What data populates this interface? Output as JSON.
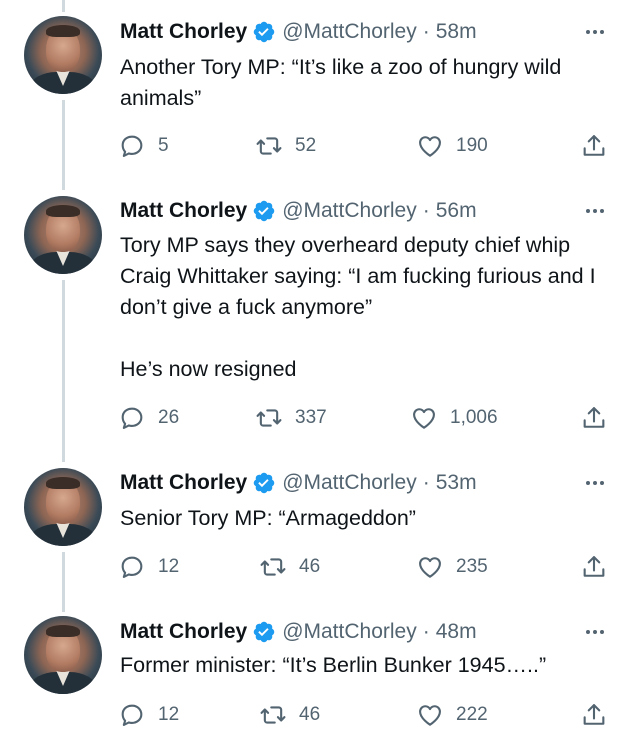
{
  "thread": {
    "tweets": [
      {
        "name": "Matt Chorley",
        "handle": "@MattChorley",
        "separator": "·",
        "time": "58m",
        "text": "Another Tory MP: “It’s like a zoo of hungry wild animals”",
        "replies": "5",
        "retweets": "52",
        "likes": "190"
      },
      {
        "name": "Matt Chorley",
        "handle": "@MattChorley",
        "separator": "·",
        "time": "56m",
        "text": "Tory MP says they overheard deputy chief whip Craig Whittaker saying: “I am fucking furious and I don’t give a fuck anymore”\n\nHe’s now resigned",
        "replies": "26",
        "retweets": "337",
        "likes": "1,006"
      },
      {
        "name": "Matt Chorley",
        "handle": "@MattChorley",
        "separator": "·",
        "time": "53m",
        "text": "Senior Tory MP: “Armageddon”",
        "replies": "12",
        "retweets": "46",
        "likes": "235"
      },
      {
        "name": "Matt Chorley",
        "handle": "@MattChorley",
        "separator": "·",
        "time": "48m",
        "text": "Former minister: “It’s Berlin Bunker 1945…..”",
        "replies": "12",
        "retweets": "46",
        "likes": "222"
      }
    ]
  },
  "icons": {
    "verified": "verified-badge-icon",
    "more": "more-dots-icon",
    "reply": "reply-bubble-icon",
    "retweet": "retweet-arrows-icon",
    "like": "heart-icon",
    "share": "share-upload-icon"
  },
  "colors": {
    "text": "#0f1419",
    "secondary": "#536471",
    "verified": "#1d9bf0",
    "thread_line": "#cfd9de",
    "background": "#ffffff"
  }
}
